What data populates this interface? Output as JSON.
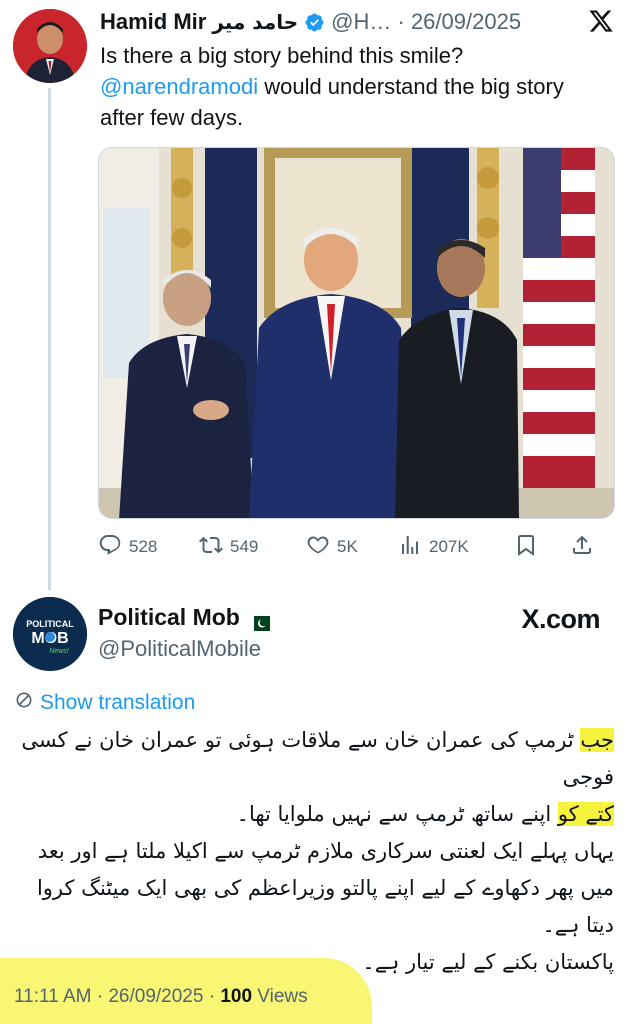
{
  "quoted_tweet": {
    "display_name": "Hamid Mir",
    "urdu_name": "حامد میر",
    "handle_time": "@H… · 26/09/2025",
    "text_before": "Is there a big story behind this smile?",
    "mention": "@narendramodi",
    "text_after": " would understand the big story after few days.",
    "stats": {
      "replies": "528",
      "reposts": "549",
      "likes": "5K",
      "views": "207K"
    }
  },
  "main_tweet": {
    "display_name": "Political Mob",
    "handle": "@PoliticalMobile",
    "watermark": "X.com",
    "avatar_text": "POLITICAL MOB",
    "show_translation": "Show translation",
    "urdu_lines": [
      {
        "highlight": "جب",
        "text": " ٹرمپ کی عمران خان سے ملاقات ہوئی تو عمران خان نے کسی فوجی"
      },
      {
        "highlight": "کتے کو",
        "text": " اپنے ساتھ ٹرمپ سے نہیں ملوایا تھا۔"
      },
      {
        "highlight": "",
        "text": "یہاں پہلے ایک لعنتی سرکاری ملازم ٹرمپ سے اکیلا ملتا ہے اور بعد میں پھر دکھاوے کے لیے اپنے پالتو وزیراعظم کی بھی ایک میٹنگ کروا دیتا ہے۔"
      },
      {
        "highlight": "",
        "text": "پاکستان بکنے کے لیے تیار ہے۔"
      }
    ],
    "time_date": "11:11 AM · 26/09/2025 · ",
    "views_count": "100",
    "views_label": " Views"
  },
  "colors": {
    "link": "#1d9bf0",
    "secondary_text": "#536471",
    "highlight": "#f6f33f"
  }
}
